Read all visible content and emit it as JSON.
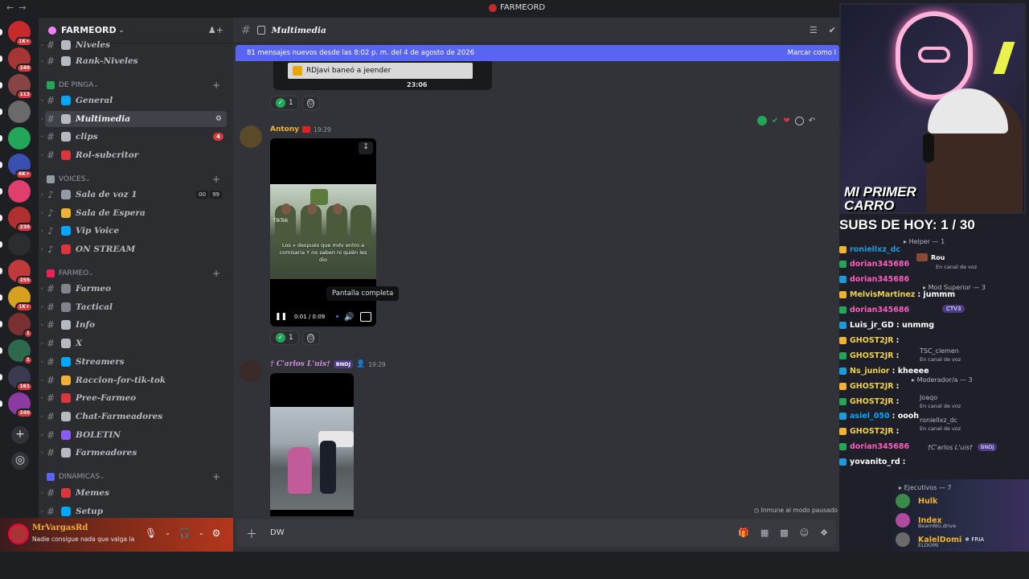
{
  "app": {
    "title": "FARMEORD"
  },
  "rail": {
    "servers": [
      {
        "color": "#c62a2a",
        "badge": "1K+"
      },
      {
        "color": "#a73535",
        "badge": "240"
      },
      {
        "color": "#884444",
        "badge": "113"
      },
      {
        "color": "#6a6a6a",
        "badge": ""
      },
      {
        "color": "#23a55a",
        "badge": ""
      },
      {
        "color": "#3b4fb0",
        "badge": "6K+"
      },
      {
        "color": "#e03e6d",
        "badge": ""
      },
      {
        "color": "#b03030",
        "badge": "230"
      },
      {
        "color": "#2b2d31",
        "badge": ""
      },
      {
        "color": "#c03a3a",
        "badge": "255"
      },
      {
        "color": "#d6a020",
        "badge": "1K+"
      },
      {
        "color": "#7a3030",
        "badge": "1"
      },
      {
        "color": "#2d6a4d",
        "badge": "1"
      },
      {
        "color": "#3a3a50",
        "badge": "161"
      },
      {
        "color": "#8a3aa0",
        "badge": "240"
      }
    ]
  },
  "sidebar": {
    "guild_name": "FARMEORD",
    "channels_top": [
      {
        "name": "Niveles",
        "color": "#b5bac1"
      },
      {
        "name": "Rank-Niveles",
        "color": "#b5bac1"
      }
    ],
    "categories": [
      {
        "name": "DE PINGA",
        "color": "#23a55a"
      },
      {
        "name": "VOICES",
        "color": "#949ba4"
      },
      {
        "name": "FARMEO",
        "color": "#e25"
      },
      {
        "name": "DINAMICAS",
        "color": "#5865f2"
      }
    ],
    "channels_depinga": [
      {
        "name": "General",
        "color": "#00a8fc",
        "pill": ""
      },
      {
        "name": "Multimedia",
        "color": "#b5bac1",
        "pill": ""
      },
      {
        "name": "clips",
        "color": "#b5bac1",
        "pill": "4"
      },
      {
        "name": "Rol-subcritor",
        "color": "#da373c",
        "pill": ""
      }
    ],
    "voices": [
      {
        "name": "Sala de voz 1",
        "color": "#949ba4",
        "counts": [
          "00",
          "99"
        ]
      },
      {
        "name": "Sala de Espera",
        "color": "#f0b232",
        "counts": []
      },
      {
        "name": "Vip Voice",
        "color": "#00a8fc",
        "counts": []
      },
      {
        "name": "ON STREAM",
        "color": "#da373c",
        "counts": []
      }
    ],
    "channels_farmeo": [
      {
        "name": "Farmeo",
        "color": "#80848e"
      },
      {
        "name": "Tactical",
        "color": "#80848e"
      },
      {
        "name": "Info",
        "color": "#b5bac1"
      },
      {
        "name": "X",
        "color": "#b5bac1"
      },
      {
        "name": "Streamers",
        "color": "#00a8fc"
      },
      {
        "name": "Raccion-for-tik-tok",
        "color": "#f0b232"
      },
      {
        "name": "Pree-Farmeo",
        "color": "#da373c"
      },
      {
        "name": "Chat-Farmeadores",
        "color": "#b5bac1"
      },
      {
        "name": "BOLETIN",
        "color": "#8a5cf6"
      },
      {
        "name": "Farmeadores",
        "color": "#b5bac1"
      }
    ],
    "channels_dinamicas": [
      {
        "name": "Memes",
        "color": "#da373c"
      },
      {
        "name": "Setup",
        "color": "#00a8fc"
      }
    ]
  },
  "user": {
    "name": "MrVargasRd",
    "status": "Nadie consigue nada que valga la p..."
  },
  "chat": {
    "channel": "Multimedia",
    "new_messages": "81 mensajes nuevos desde las 8:02 p. m. del 4 de agosto de 2026",
    "mark_read": "Marcar como l",
    "old_image_text": "RDjavi baneó a jeender",
    "old_image_time": "23:06",
    "reaction_count": "1",
    "msg1": {
      "author": "Antony",
      "time": "19:29",
      "author_color": "#f0b232"
    },
    "video": {
      "caption": "Los « después que mdv entro a comisaria Y no saben ni quién les dio",
      "watermark": "TikTok",
      "time": "0:01 / 0:09",
      "tooltip": "Pantalla completa"
    },
    "msg2": {
      "author": "† C'arlos L'uis†",
      "tag": "BNDJ",
      "time": "19:29",
      "author_color": "#d08cd6"
    },
    "immune": "Inmune al modo pausado",
    "composer_text": "DW"
  },
  "overlay": {
    "cam_banner_1": "MI PRIMER",
    "cam_banner_2": "CARRO",
    "subs": "SUBS DE HOY: 1 / 30",
    "feed": [
      {
        "user": "roniellxz_dc",
        "text": "",
        "color": "#1e9bd7"
      },
      {
        "user": "dorian345686",
        "text": "",
        "color": "#ff5dbf"
      },
      {
        "user": "dorian345686",
        "text": "",
        "color": "#ff5dbf"
      },
      {
        "user": "MelvisMartinez",
        "text": ": jummm",
        "color": "#f0d24a"
      },
      {
        "user": "dorian345686",
        "text": "",
        "color": "#ff5dbf"
      },
      {
        "user": "Luis_jr_GD",
        "text": ": unmmg",
        "color": "#ffffff"
      },
      {
        "user": "GHOST2JR",
        "text": ":",
        "color": "#f0d24a"
      },
      {
        "user": "GHOST2JR",
        "text": ":",
        "color": "#f0d24a"
      },
      {
        "user": "Ns_junior",
        "text": ": kheeee",
        "color": "#f0d24a"
      },
      {
        "user": "GHOST2JR",
        "text": ":",
        "color": "#f0d24a"
      },
      {
        "user": "GHOST2JR",
        "text": ":",
        "color": "#f0d24a"
      },
      {
        "user": "asiel_050",
        "text": ": oooh",
        "color": "#00a8fc"
      },
      {
        "user": "GHOST2JR",
        "text": ":",
        "color": "#f0d24a"
      },
      {
        "user": "dorian345686",
        "text": "",
        "color": "#ff5dbf"
      },
      {
        "user": "yovanito_rd",
        "text": ":",
        "color": "#ffffff"
      }
    ],
    "voice_panel": {
      "helper": "Helper — 1",
      "mod_superior": "Mod Superior — 3",
      "moderador": "Moderador/a — 3",
      "in_voice": "En canal de voz",
      "ctv3": "CTV3",
      "members": [
        "Rou",
        "TSC_clemen",
        "Joaqo",
        "roniellxz_dc"
      ],
      "carlos": "†C'arlos L'uis†",
      "bndj": "BNDJ"
    },
    "executives": {
      "header": "Ejecutivos — 7",
      "members": [
        {
          "name": "Hulk",
          "sub": "",
          "extra": "",
          "color": "#f0b232"
        },
        {
          "name": "Index",
          "sub": "BeamNG.drive",
          "extra": "",
          "color": "#f0b232"
        },
        {
          "name": "KalelDomi",
          "sub": "ELDOMI",
          "extra": "FRIA",
          "color": "#f0b232"
        }
      ]
    }
  }
}
